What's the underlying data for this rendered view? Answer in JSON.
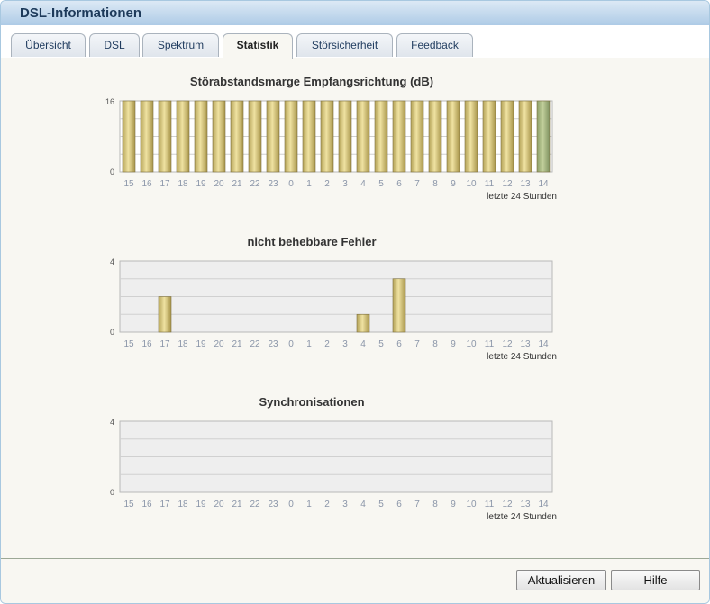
{
  "window": {
    "title": "DSL-Informationen"
  },
  "tabs": [
    {
      "label": "Übersicht",
      "active": false
    },
    {
      "label": "DSL",
      "active": false
    },
    {
      "label": "Spektrum",
      "active": false
    },
    {
      "label": "Statistik",
      "active": true
    },
    {
      "label": "Störsicherheit",
      "active": false
    },
    {
      "label": "Feedback",
      "active": false
    }
  ],
  "chart_data": [
    {
      "type": "bar",
      "title": "Störabstandsmarge Empfangsrichtung (dB)",
      "categories": [
        "15",
        "16",
        "17",
        "18",
        "19",
        "20",
        "21",
        "22",
        "23",
        "0",
        "1",
        "2",
        "3",
        "4",
        "5",
        "6",
        "7",
        "8",
        "9",
        "10",
        "11",
        "12",
        "13",
        "14"
      ],
      "values": [
        16,
        16,
        16,
        16,
        16,
        16,
        16,
        16,
        16,
        16,
        16,
        16,
        16,
        16,
        16,
        16,
        16,
        16,
        16,
        16,
        16,
        16,
        16,
        16
      ],
      "ylim": [
        0,
        16
      ],
      "yticks": [
        "0",
        "16"
      ],
      "xlabel": "letzte 24 Stunden",
      "colors": {
        "bar": "#d4c27a",
        "highlight": "#9db07a",
        "plot_bg": "#ffffff"
      }
    },
    {
      "type": "bar",
      "title": "nicht behebbare Fehler",
      "categories": [
        "15",
        "16",
        "17",
        "18",
        "19",
        "20",
        "21",
        "22",
        "23",
        "0",
        "1",
        "2",
        "3",
        "4",
        "5",
        "6",
        "7",
        "8",
        "9",
        "10",
        "11",
        "12",
        "13",
        "14"
      ],
      "values": [
        0,
        0,
        2,
        0,
        0,
        0,
        0,
        0,
        0,
        0,
        0,
        0,
        0,
        1,
        0,
        3,
        0,
        0,
        0,
        0,
        0,
        0,
        0,
        0
      ],
      "ylim": [
        0,
        4
      ],
      "yticks": [
        "0",
        "4"
      ],
      "xlabel": "letzte 24 Stunden",
      "colors": {
        "bar": "#d4c27a",
        "plot_bg": "#eeeeee"
      }
    },
    {
      "type": "bar",
      "title": "Synchronisationen",
      "categories": [
        "15",
        "16",
        "17",
        "18",
        "19",
        "20",
        "21",
        "22",
        "23",
        "0",
        "1",
        "2",
        "3",
        "4",
        "5",
        "6",
        "7",
        "8",
        "9",
        "10",
        "11",
        "12",
        "13",
        "14"
      ],
      "values": [
        0,
        0,
        0,
        0,
        0,
        0,
        0,
        0,
        0,
        0,
        0,
        0,
        0,
        0,
        0,
        0,
        0,
        0,
        0,
        0,
        0,
        0,
        0,
        0
      ],
      "ylim": [
        0,
        4
      ],
      "yticks": [
        "0",
        "4"
      ],
      "xlabel": "letzte 24 Stunden",
      "colors": {
        "bar": "#d4c27a",
        "plot_bg": "#eeeeee"
      }
    }
  ],
  "buttons": {
    "refresh": "Aktualisieren",
    "help": "Hilfe"
  }
}
